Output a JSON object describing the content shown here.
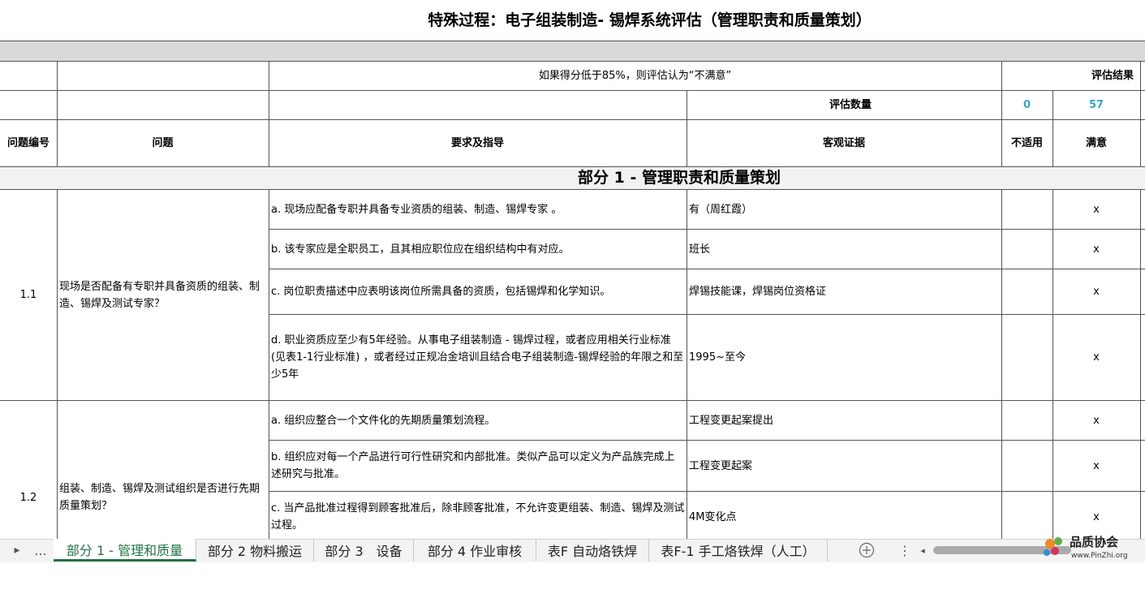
{
  "title": "特殊过程：电子组装制造- 锡焊系统评估（管理职责和质量策划）",
  "header": {
    "threshold_note": "如果得分低于85%，则评估认为“不满意”",
    "result_label": "评估结果",
    "count_label": "评估数量",
    "count_na": "0",
    "count_ok": "57",
    "col_no": "问题编号",
    "col_question": "问题",
    "col_requirement": "要求及指导",
    "col_evidence": "客观证据",
    "col_na": "不适用",
    "col_ok": "满意"
  },
  "section_title": "部分 1 - 管理职责和质量策划",
  "items": [
    {
      "no": "1.1",
      "question": "现场是否配备有专职并具备资质的组装、制造、锡焊及测试专家？",
      "rows": [
        {
          "req": "a.  现场应配备专职并具备专业资质的组装、制造、锡焊专家 。",
          "evidence": "有（周红霞）",
          "ok": "x"
        },
        {
          "req": "b.  该专家应是全职员工，且其相应职位应在组织结构中有对应。",
          "evidence": "班长",
          "ok": "x"
        },
        {
          "req": "c.  岗位职责描述中应表明该岗位所需具备的资质，包括锡焊和化学知识。",
          "evidence": "焊锡技能课，焊锡岗位资格证",
          "ok": "x"
        },
        {
          "req": "d.  职业资质应至少有5年经验。从事电子组装制造 - 锡焊过程，或者应用相关行业标准(见表1-1行业标准) ，或者经过正规冶金培训且结合电子组装制造-锡焊经验的年限之和至少5年",
          "evidence": "1995~至今",
          "ok": "x"
        }
      ]
    },
    {
      "no": "1.2",
      "question": "组装、制造、锡焊及测试组织是否进行先期质量策划？",
      "rows": [
        {
          "req": "a.  组织应整合一个文件化的先期质量策划流程。",
          "evidence": "工程变更起案提出",
          "ok": "x"
        },
        {
          "req": "b.  组织应对每一个产品进行可行性研究和内部批准。类似产品可以定义为产品族完成上述研究与批准。",
          "evidence": "工程变更起案",
          "ok": "x"
        },
        {
          "req": "c.  当产品批准过程得到顾客批准后，除非顾客批准，不允许变更组装、制造、锡焊及测试过程。",
          "evidence": "4M变化点",
          "ok": "x"
        }
      ]
    }
  ],
  "tabs": {
    "ellipsis": "...",
    "list": [
      "部分 1 - 管理和质量",
      "部分 2 物料搬运",
      "部分 3　设备",
      "部分 4  作业审核",
      "表F 自动烙铁焊",
      "表F-1 手工烙铁焊（人工）"
    ]
  },
  "logo": {
    "name": "品质协会",
    "url": "www.PinZhi.org"
  },
  "colors": {
    "accent_green": "#217346",
    "count_blue": "#3aa3c7"
  }
}
